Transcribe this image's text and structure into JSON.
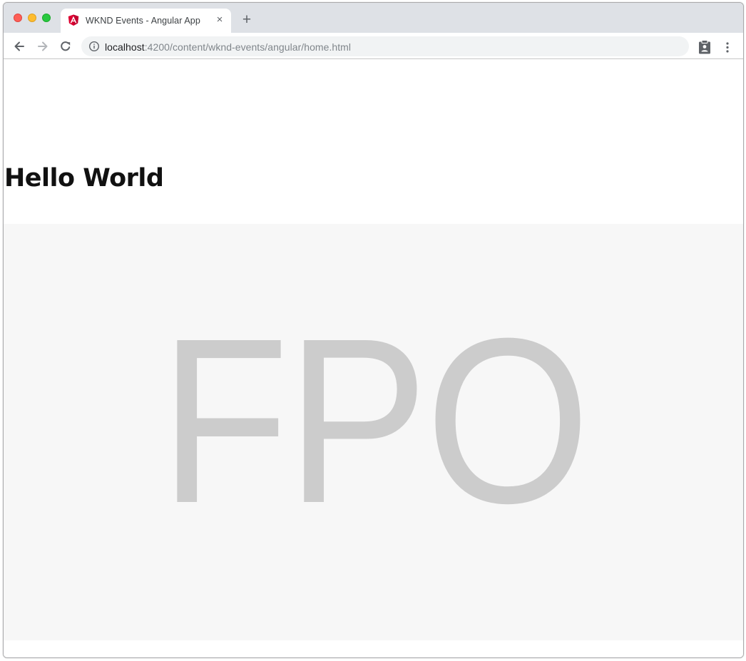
{
  "tab": {
    "title": "WKND Events - Angular App",
    "close_glyph": "×",
    "favicon": "angular-logo-icon"
  },
  "new_tab_glyph": "+",
  "address_bar": {
    "host": "localhost",
    "path": ":4200/content/wknd-events/angular/home.html"
  },
  "page": {
    "heading": "Hello World",
    "placeholder_text": "FPO"
  },
  "colors": {
    "angular_red": "#dd0031",
    "placeholder_bg": "#f7f7f7",
    "placeholder_glyph": "#cccccc"
  }
}
